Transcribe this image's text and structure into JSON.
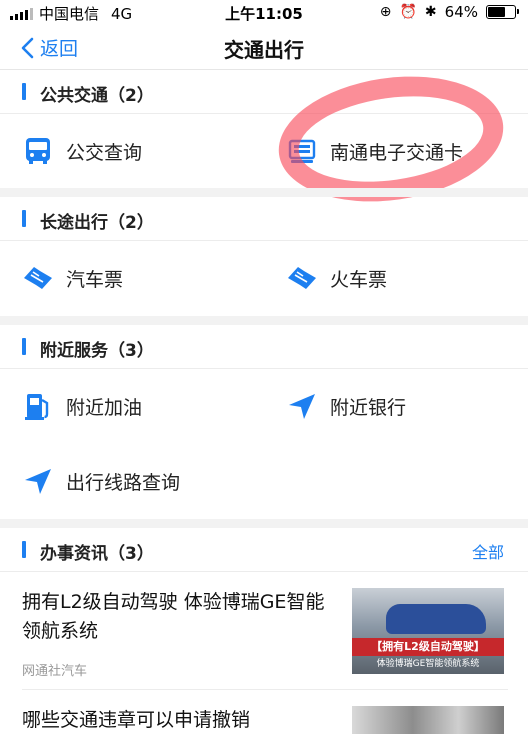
{
  "status_bar": {
    "carrier": "中国电信",
    "network": "4G",
    "time": "上午11:05",
    "battery": "64%",
    "battery_level": 0.64
  },
  "nav": {
    "back_label": "返回",
    "title": "交通出行"
  },
  "sections": [
    {
      "label": "公共交通（2）",
      "items": [
        {
          "label": "公交查询",
          "icon": "bus-icon"
        },
        {
          "label": "南通电子交通卡",
          "icon": "transit-card-icon"
        }
      ]
    },
    {
      "label": "长途出行（2）",
      "items": [
        {
          "label": "汽车票",
          "icon": "ticket-icon"
        },
        {
          "label": "火车票",
          "icon": "ticket-icon"
        }
      ]
    },
    {
      "label": "附近服务（3）",
      "items": [
        {
          "label": "附近加油",
          "icon": "fuel-pump-icon"
        },
        {
          "label": "附近银行",
          "icon": "location-arrow-icon"
        },
        {
          "label": "出行线路查询",
          "icon": "location-arrow-icon"
        }
      ]
    },
    {
      "label": "办事资讯（3）",
      "more_label": "全部"
    }
  ],
  "news": [
    {
      "title": "拥有L2级自动驾驶 体验博瑞GE智能领航系统",
      "source": "网通社汽车",
      "thumb_banner": "【拥有L2级自动驾驶】",
      "thumb_caption": "体验博瑞GE智能领航系统"
    },
    {
      "title": "哪些交通违章可以申请撤销"
    }
  ],
  "colors": {
    "accent": "#1d7ff0",
    "annotation": "#f84858"
  }
}
